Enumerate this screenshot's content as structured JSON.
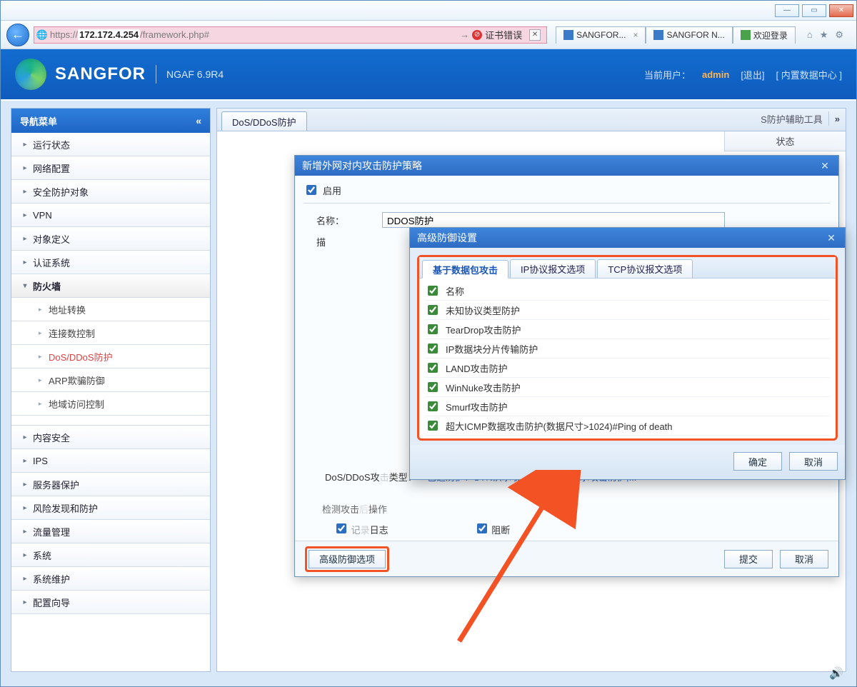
{
  "browser": {
    "url_prefix": "https://",
    "url_host": "172.172.4.254",
    "url_path": "/framework.php#",
    "cert_error": "证书错误",
    "tabs": [
      {
        "label": "SANGFOR...",
        "active": true
      },
      {
        "label": "SANGFOR N..."
      },
      {
        "label": "欢迎登录"
      }
    ]
  },
  "header": {
    "brand": "SANGFOR",
    "product": "NGAF 6.9R4",
    "current_user_label": "当前用户：",
    "current_user": "admin",
    "logout": "[退出]",
    "data_center": "[ 内置数据中心 ]"
  },
  "sidebar": {
    "title": "导航菜单",
    "items": [
      {
        "label": "运行状态"
      },
      {
        "label": "网络配置"
      },
      {
        "label": "安全防护对象"
      },
      {
        "label": "VPN"
      },
      {
        "label": "对象定义"
      },
      {
        "label": "认证系统"
      }
    ],
    "firewall": {
      "label": "防火墙",
      "children": [
        {
          "label": "地址转换"
        },
        {
          "label": "连接数控制"
        },
        {
          "label": "DoS/DDoS防护",
          "active": true
        },
        {
          "label": "ARP欺骗防御"
        },
        {
          "label": "地域访问控制"
        }
      ]
    },
    "items2": [
      {
        "label": "内容安全"
      },
      {
        "label": "IPS"
      },
      {
        "label": "服务器保护"
      },
      {
        "label": "风险发现和防护"
      },
      {
        "label": "流量管理"
      },
      {
        "label": "系统"
      },
      {
        "label": "系统维护"
      },
      {
        "label": "配置向导"
      }
    ]
  },
  "content": {
    "tab": "DoS/DDoS防护",
    "right_tool": "S防护辅助工具",
    "status_col": "状态"
  },
  "policy_modal": {
    "title": "新增外网对内攻击防护策略",
    "enable": "启用",
    "name_label": "名称：",
    "name_value": "DDOS防护",
    "desc_label": "描",
    "type_label": "DoS/DDoS攻",
    "type_label_suffix": "类型：",
    "selected_prefix": "已选防护：",
    "selected_value": "SYN洪水攻击防护,UDP洪水攻击防护,...",
    "detect_legend": "检测攻击",
    "detect_legend_suffix": "操作",
    "log": "记录日志",
    "block": "阻断",
    "adv_btn": "高级防御选项",
    "submit": "提交",
    "cancel": "取消"
  },
  "adv_modal": {
    "title": "高级防御设置",
    "tabs": [
      "基于数据包攻击",
      "IP协议报文选项",
      "TCP协议报文选项"
    ],
    "checks": [
      "名称",
      "未知协议类型防护",
      "TearDrop攻击防护",
      "IP数据块分片传输防护",
      "LAND攻击防护",
      "WinNuke攻击防护",
      "Smurf攻击防护",
      "超大ICMP数据攻击防护(数据尺寸>1024)#Ping of death"
    ],
    "ok": "确定",
    "cancel": "取消"
  }
}
